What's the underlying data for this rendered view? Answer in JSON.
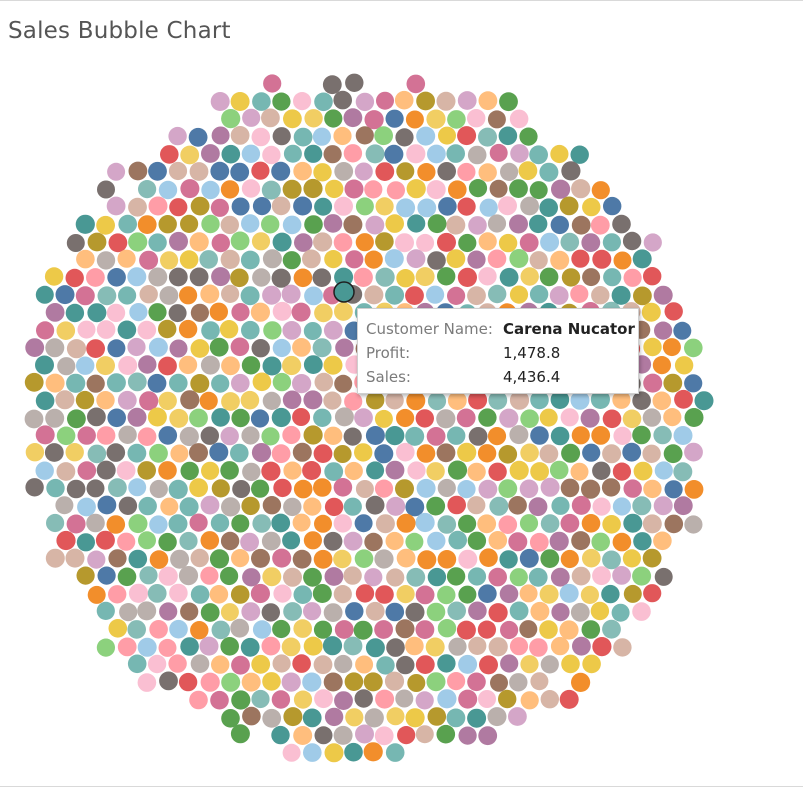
{
  "chart_data": {
    "type": "scatter",
    "title": "Sales Bubble Chart",
    "tooltip": {
      "rows": [
        {
          "label": "Customer Name:",
          "value": "Carena Nucator"
        },
        {
          "label": "Profit:",
          "value": "1,478.8"
        },
        {
          "label": "Sales:",
          "value": "4,436.4"
        }
      ]
    },
    "palette": [
      "#4e79a7",
      "#f28e2b",
      "#e15759",
      "#76b7b2",
      "#59a14f",
      "#edc948",
      "#b07aa1",
      "#ff9da7",
      "#9c755f",
      "#bab0ac",
      "#a0cbe8",
      "#8cd17d",
      "#b6992d",
      "#f1ce63",
      "#499894",
      "#86bcb6",
      "#d37295",
      "#fabfd2",
      "#d4a6c8",
      "#79706e",
      "#ffbe7d",
      "#d7b5a6"
    ],
    "highlight_color": "#499894"
  }
}
